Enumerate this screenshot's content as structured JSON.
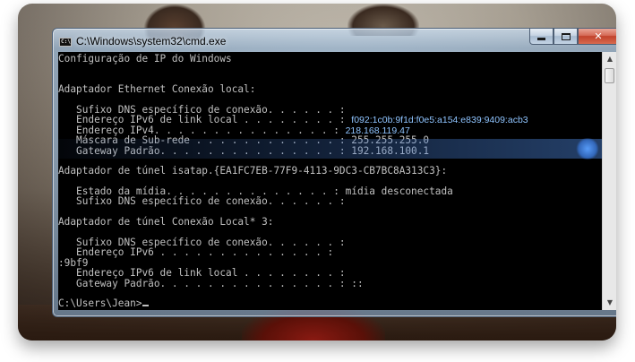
{
  "window": {
    "title": "C:\\Windows\\system32\\cmd.exe",
    "icon_text": "C:\\",
    "buttons": {
      "minimize": "minimize",
      "maximize": "maximize",
      "close": "✕"
    }
  },
  "console": {
    "lines": [
      "Configuração de IP do Windows",
      "",
      "",
      "Adaptador Ethernet Conexão local:",
      "",
      "   Sufixo DNS específico de conexão. . . . . . :",
      "   Endereço IPv6 de link local . . . . . . . . : ",
      "   Endereço IPv4. . . . . . . . . . . . . . . : ",
      "   Máscara de Sub-rede . . . . . . . . . . . . : 255.255.255.0",
      "   Gateway Padrão. . . . . . . . . . . . . . . : 192.168.100.1",
      "",
      "Adaptador de túnel isatap.{EA1FC7EB-77F9-4113-9DC3-CB7BC8A313C3}:",
      "",
      "   Estado da mídia. . . . . . . . . . . . . . : mídia desconectada",
      "   Sufixo DNS específico de conexão. . . . . . :",
      "",
      "Adaptador de túnel Conexão Local* 3:",
      "",
      "   Sufixo DNS específico de conexão. . . . . . :",
      "   Endereço IPv6 . . . . . . . . . . . . . . : ",
      ":9bf9",
      "   Endereço IPv6 de link local . . . . . . . . : ",
      "   Gateway Padrão. . . . . . . . . . . . . . . : ::",
      "",
      "C:\\Users\\Jean>"
    ],
    "highlight": {
      "ipv6_link_local": "f092:1c0b:9f1d:f0e5:a154:e839:9409:acb3",
      "ipv4": "218.168.119.47"
    }
  }
}
